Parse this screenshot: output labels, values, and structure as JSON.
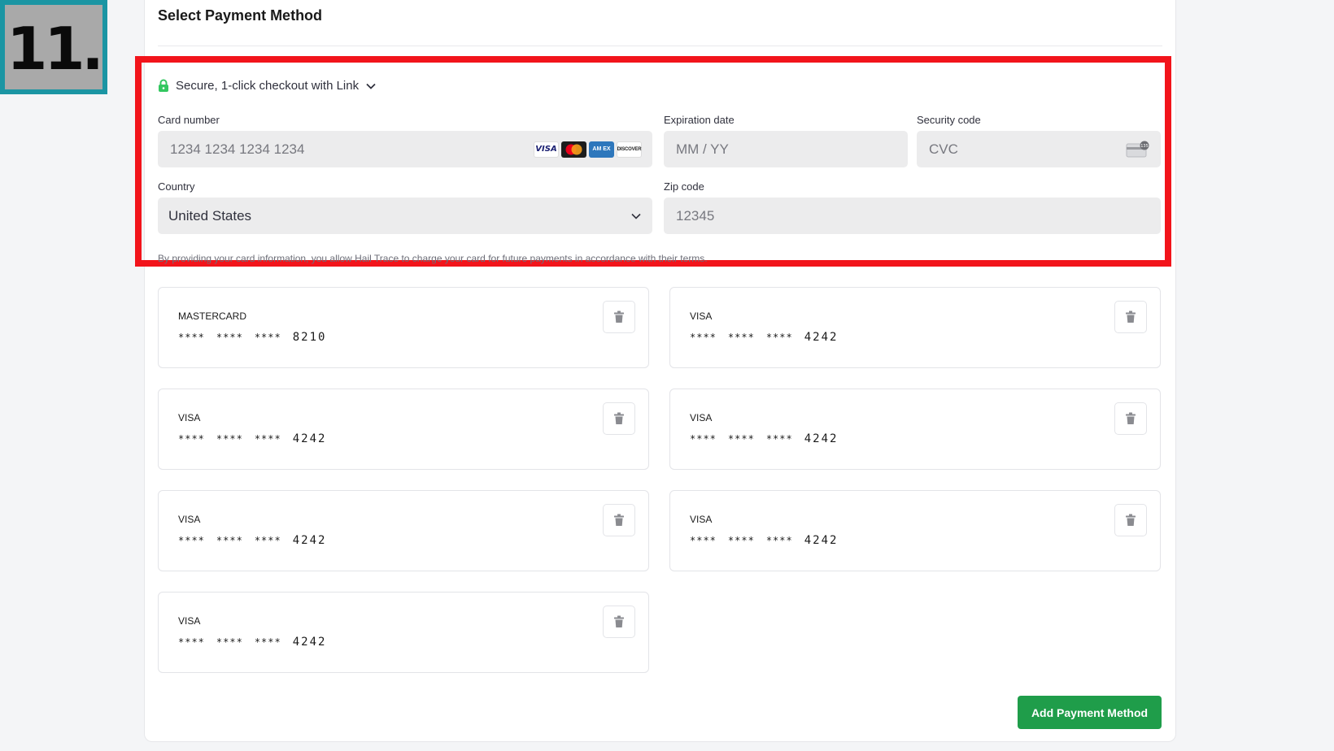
{
  "step_badge": {
    "text": "11."
  },
  "page": {
    "title": "Select Payment Method"
  },
  "link": {
    "label": "Secure, 1-click checkout with Link"
  },
  "form": {
    "card_number": {
      "label": "Card number",
      "placeholder": "1234 1234 1234 1234"
    },
    "expiration": {
      "label": "Expiration date",
      "placeholder": "MM / YY"
    },
    "security": {
      "label": "Security code",
      "placeholder": "CVC"
    },
    "country": {
      "label": "Country",
      "value": "United States"
    },
    "zip": {
      "label": "Zip code",
      "placeholder": "12345"
    },
    "card_logos": {
      "visa": "VISA",
      "amex": "AM EX",
      "discover": "DISCOVER"
    },
    "terms": "By providing your card information, you allow Hail Trace to charge your card for future payments in accordance with their terms."
  },
  "saved_cards": [
    {
      "brand": "MASTERCARD",
      "masked": [
        "****",
        "****",
        "****"
      ],
      "last4": "8210"
    },
    {
      "brand": "VISA",
      "masked": [
        "****",
        "****",
        "****"
      ],
      "last4": "4242"
    },
    {
      "brand": "VISA",
      "masked": [
        "****",
        "****",
        "****"
      ],
      "last4": "4242"
    },
    {
      "brand": "VISA",
      "masked": [
        "****",
        "****",
        "****"
      ],
      "last4": "4242"
    },
    {
      "brand": "VISA",
      "masked": [
        "****",
        "****",
        "****"
      ],
      "last4": "4242"
    },
    {
      "brand": "VISA",
      "masked": [
        "****",
        "****",
        "****"
      ],
      "last4": "4242"
    },
    {
      "brand": "VISA",
      "masked": [
        "****",
        "****",
        "****"
      ],
      "last4": "4242"
    }
  ],
  "actions": {
    "add_label": "Add Payment Method"
  },
  "icons": {
    "lock": "lock-icon",
    "chevron": "chevron-down-icon",
    "trash": "trash-icon",
    "cvc": "cvc-card-icon"
  },
  "colors": {
    "accent_green": "#1f9d4a",
    "link_green": "#33c760",
    "highlight_red": "#f2141b",
    "badge_teal": "#1b95a3"
  }
}
